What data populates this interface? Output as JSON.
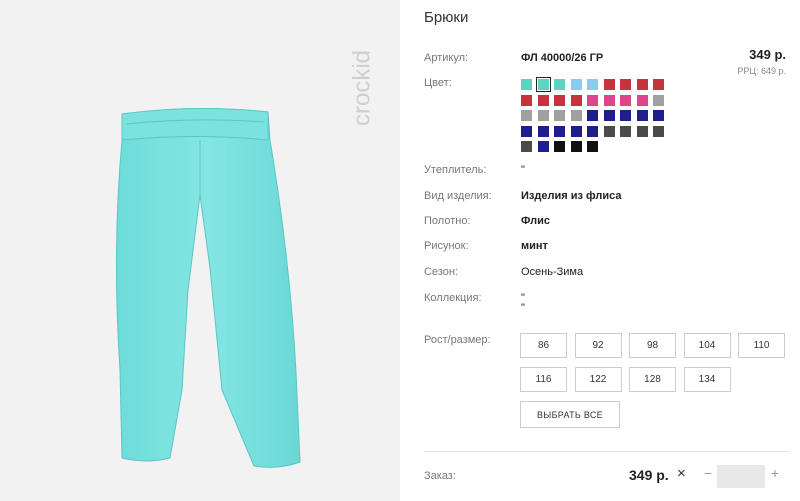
{
  "product": {
    "title": "Брюки",
    "article_label": "Артикул:",
    "article_value": "ФЛ 40000/26 ГР",
    "price": "349 р.",
    "rrc": "РРЦ: 649 р.",
    "color_label": "Цвет:",
    "brand_logo": "crockid",
    "image_icon": "pants-image"
  },
  "swatch_colors": [
    [
      "#5fd3c0",
      "#5fd3c0",
      "#5fd3c0",
      "#8ccbf0",
      "#8ccbf0",
      "#c8323c",
      "#c8323c",
      "#c8323c",
      "#c8323c"
    ],
    [
      "#c8323c",
      "#c8323c",
      "#c8323c",
      "#c8323c",
      "#e0458c",
      "#e0458c",
      "#e0458c",
      "#e0458c",
      "#a0a0a0"
    ],
    [
      "#a0a0a0",
      "#a0a0a0",
      "#a0a0a0",
      "#a0a0a0",
      "#1e1f8c",
      "#1e1f8c",
      "#1e1f8c",
      "#1e1f8c",
      "#1e1f8c"
    ],
    [
      "#1e1f8c",
      "#1e1f8c",
      "#1e1f8c",
      "#1e1f8c",
      "#1e1f8c",
      "#4a4a4a",
      "#4a4a4a",
      "#4a4a4a",
      "#4a4a4a"
    ],
    [
      "#4a4a4a",
      "#1e1f8c",
      "#111111",
      "#111111",
      "#111111"
    ]
  ],
  "selected_swatch": [
    0,
    1
  ],
  "attributes": [
    {
      "label": "Утеплитель:",
      "value": "\"",
      "bold": false
    },
    {
      "label": "Вид изделия:",
      "value": "Изделия из флиса",
      "bold": true
    },
    {
      "label": "Полотно:",
      "value": "Флис",
      "bold": true
    },
    {
      "label": "Рисунок:",
      "value": "минт",
      "bold": true
    },
    {
      "label": "Сезон:",
      "value": "Осень-Зима",
      "bold": false
    },
    {
      "label": "Коллекция:",
      "value": "\"",
      "bold": false,
      "extra": "\""
    }
  ],
  "sizes_label": "Рост/размер:",
  "sizes": [
    "86",
    "92",
    "98",
    "104",
    "110",
    "116",
    "122",
    "128",
    "134"
  ],
  "select_all": "ВЫБРАТЬ ВСЕ",
  "order": {
    "label": "Заказ:",
    "price": "349 р.",
    "times": "×",
    "minus": "−",
    "plus": "+",
    "qty": ""
  }
}
